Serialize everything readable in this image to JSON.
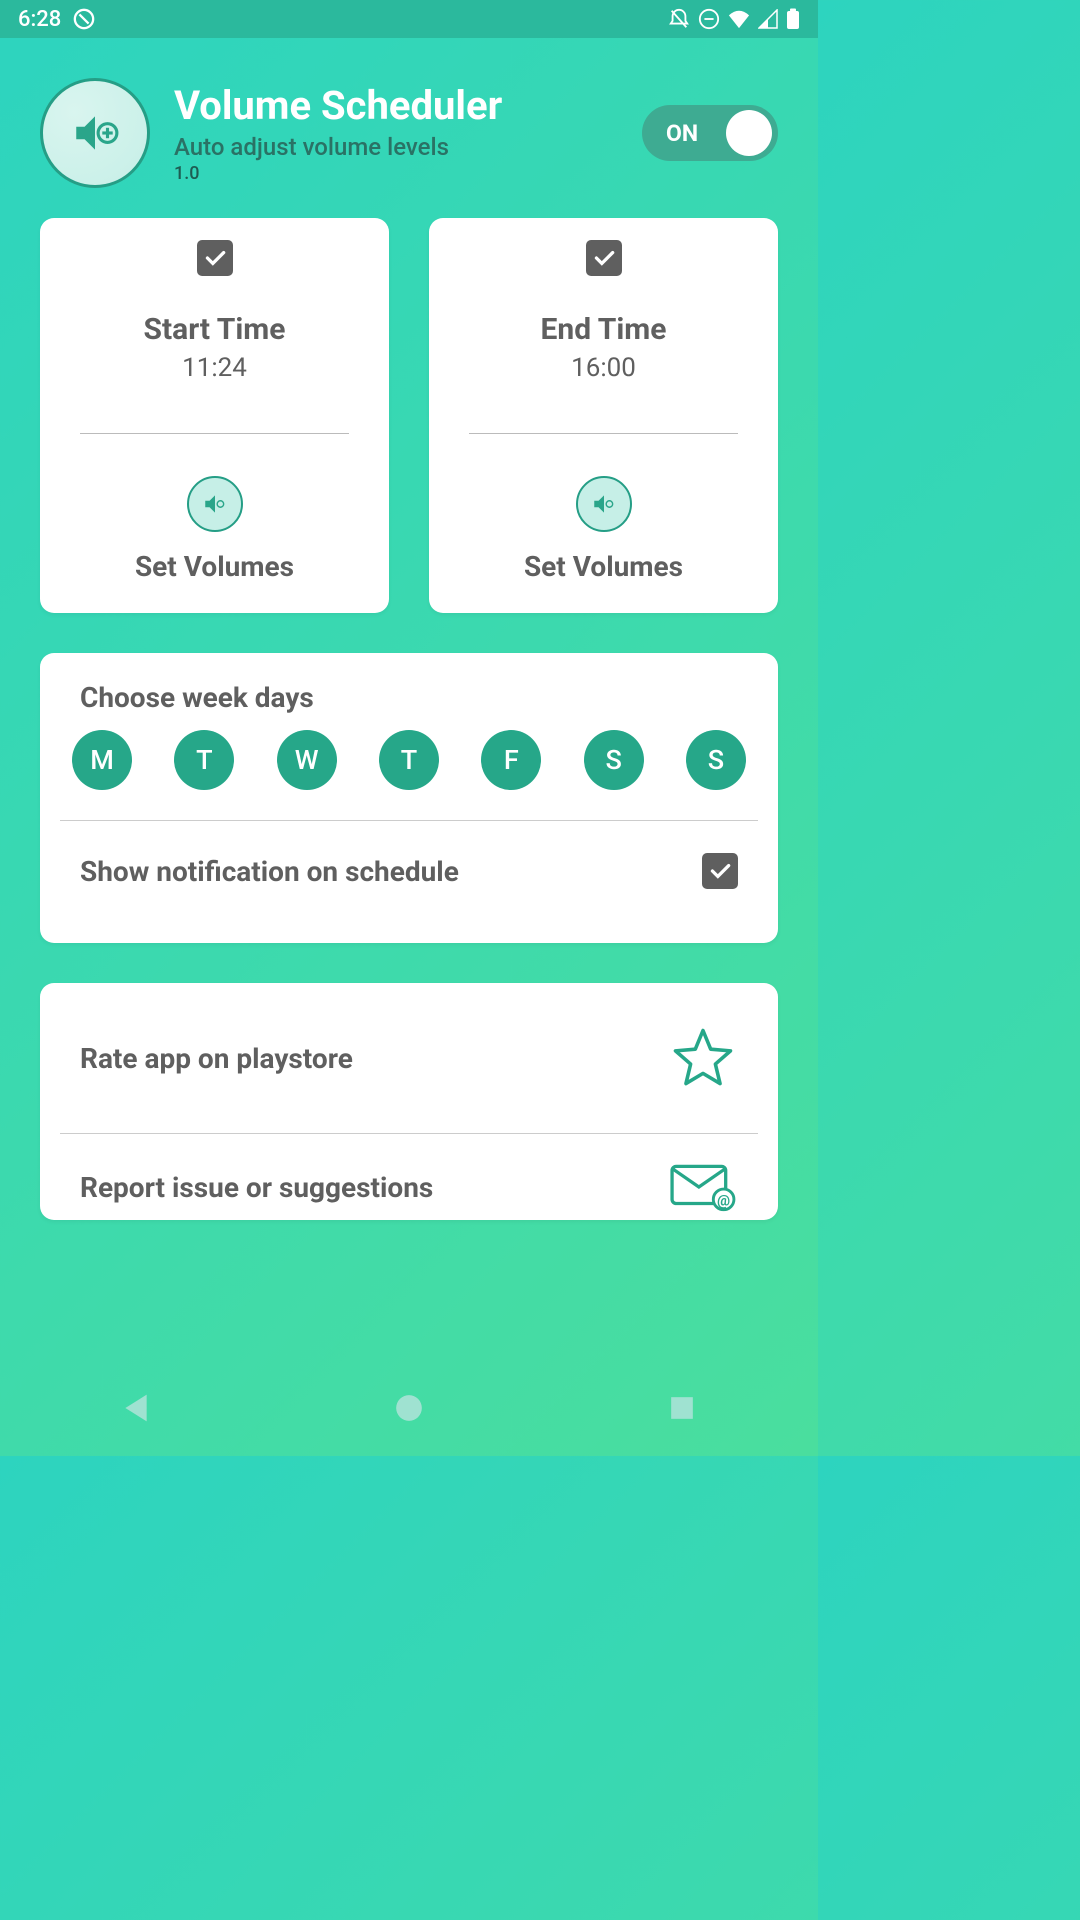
{
  "statusbar": {
    "time": "6:28"
  },
  "header": {
    "title": "Volume Scheduler",
    "subtitle": "Auto adjust volume levels",
    "version": "1.0",
    "toggle_label": "ON"
  },
  "start_card": {
    "label": "Start Time",
    "time": "11:24",
    "set_label": "Set Volumes"
  },
  "end_card": {
    "label": "End Time",
    "time": "16:00",
    "set_label": "Set Volumes"
  },
  "week": {
    "title": "Choose week days",
    "days": [
      "M",
      "T",
      "W",
      "T",
      "F",
      "S",
      "S"
    ]
  },
  "notification_label": "Show notification on schedule",
  "rate_label": "Rate app on playstore",
  "report_label": "Report issue or suggestions"
}
